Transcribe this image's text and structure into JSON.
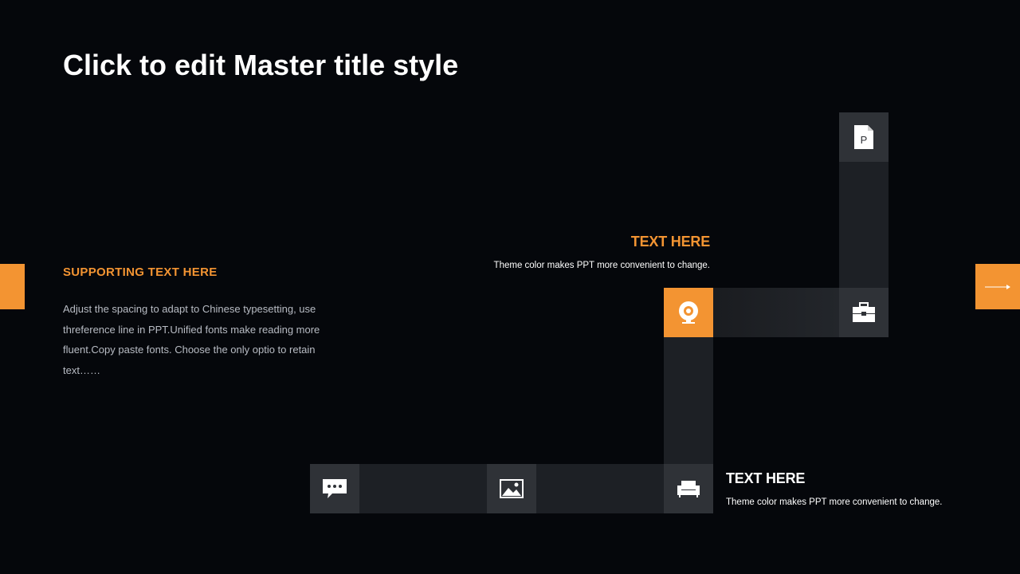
{
  "slide": {
    "title": "Click to edit Master title style"
  },
  "supporting": {
    "heading": "SUPPORTING TEXT HERE",
    "body": "Adjust the spacing to adapt to Chinese typesetting, use threference line in PPT.Unified fonts make reading more fluent.Copy paste fonts. Choose the only optio to retain text……"
  },
  "callouts": [
    {
      "heading": "TEXT HERE",
      "body": "Theme  color makes PPT more convenient to change.",
      "color": "#f39432"
    },
    {
      "heading": "TEXT HERE",
      "body": "Theme  color makes PPT more convenient to change.",
      "color": "#ffffff"
    }
  ],
  "icons": [
    "chat-bubble-icon",
    "image-icon",
    "sofa-icon",
    "webcam-icon",
    "toolbox-icon",
    "powerpoint-file-icon",
    "arrow-right-icon"
  ],
  "colors": {
    "background": "#05070b",
    "accent": "#f39432",
    "tile": "#2f3237",
    "bar": "#1d2025"
  }
}
